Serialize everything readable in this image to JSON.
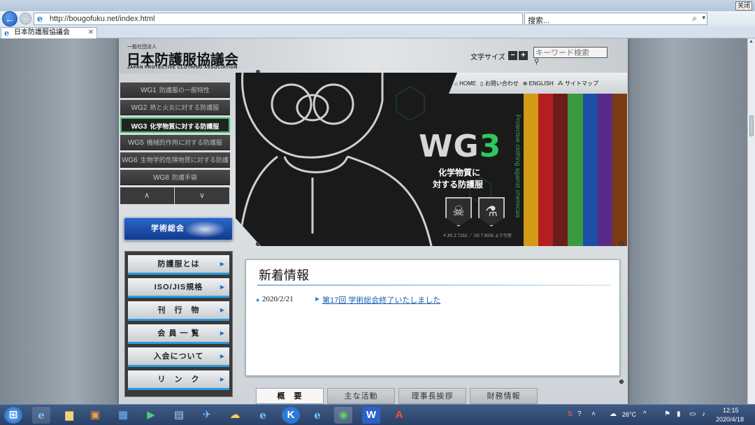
{
  "browser": {
    "close_label": "关闭",
    "url": "http://bougofuku.net/index.html",
    "search_placeholder": "搜索...",
    "tab_title": "日本防護服協議会"
  },
  "header": {
    "org_small": "一般社団法人",
    "org_name": "日本防護服協議会",
    "org_en": "JAPAN PROTECTIVE CLOTHING ASSOCIATION",
    "font_size_label": "文字サイズ",
    "font_minus": "−",
    "font_plus": "+",
    "keyword_placeholder": "キーワード検索"
  },
  "wg_menu": [
    {
      "code": "WG1",
      "label": "防護服の一般特性"
    },
    {
      "code": "WG2",
      "label": "熱と火炎に対する防護服"
    },
    {
      "code": "WG3",
      "label": "化学物質に対する防護服"
    },
    {
      "code": "WG5",
      "label": "機械的作用に対する防護服"
    },
    {
      "code": "WG6",
      "label": "生物学的危険物質に対する防護服"
    },
    {
      "code": "WG8",
      "label": "防護手袋"
    }
  ],
  "wg_nav": {
    "up": "∧",
    "down": "∨"
  },
  "subnav": {
    "home": "HOME",
    "contact": "お問い合わせ",
    "english": "ENGLISH",
    "sitemap": "サイトマップ"
  },
  "hero": {
    "title_wg": "WG",
    "title_num": "3",
    "line1": "化学物質に",
    "line2": "対する防護服",
    "vertical": "Protective clothing against chemicals",
    "jis_note": "＊JIS Z 7253 ／ JIS T 8005 より引用",
    "stripe_colors": [
      "#d39a17",
      "#b51e1e",
      "#6a1d1a",
      "#3a9a3e",
      "#1b4fa8",
      "#5a2a8a",
      "#7a3b12"
    ]
  },
  "academic_button": "学術総会",
  "main_nav": [
    "防護服とは",
    "ISO/JIS規格",
    "刊　行　物",
    "会 員 一 覧",
    "入会について",
    "リ　ン　ク"
  ],
  "news": {
    "title": "新着情報",
    "items": [
      {
        "date": "2020/2/21",
        "text": "第17回 学術総会終了いたしました"
      }
    ]
  },
  "bottom_tabs": [
    "概　要",
    "主な活動",
    "理事長挨拶",
    "財務情報"
  ],
  "taskbar": {
    "temp": "26°C",
    "time": "12:15",
    "date": "2020/4/18"
  }
}
